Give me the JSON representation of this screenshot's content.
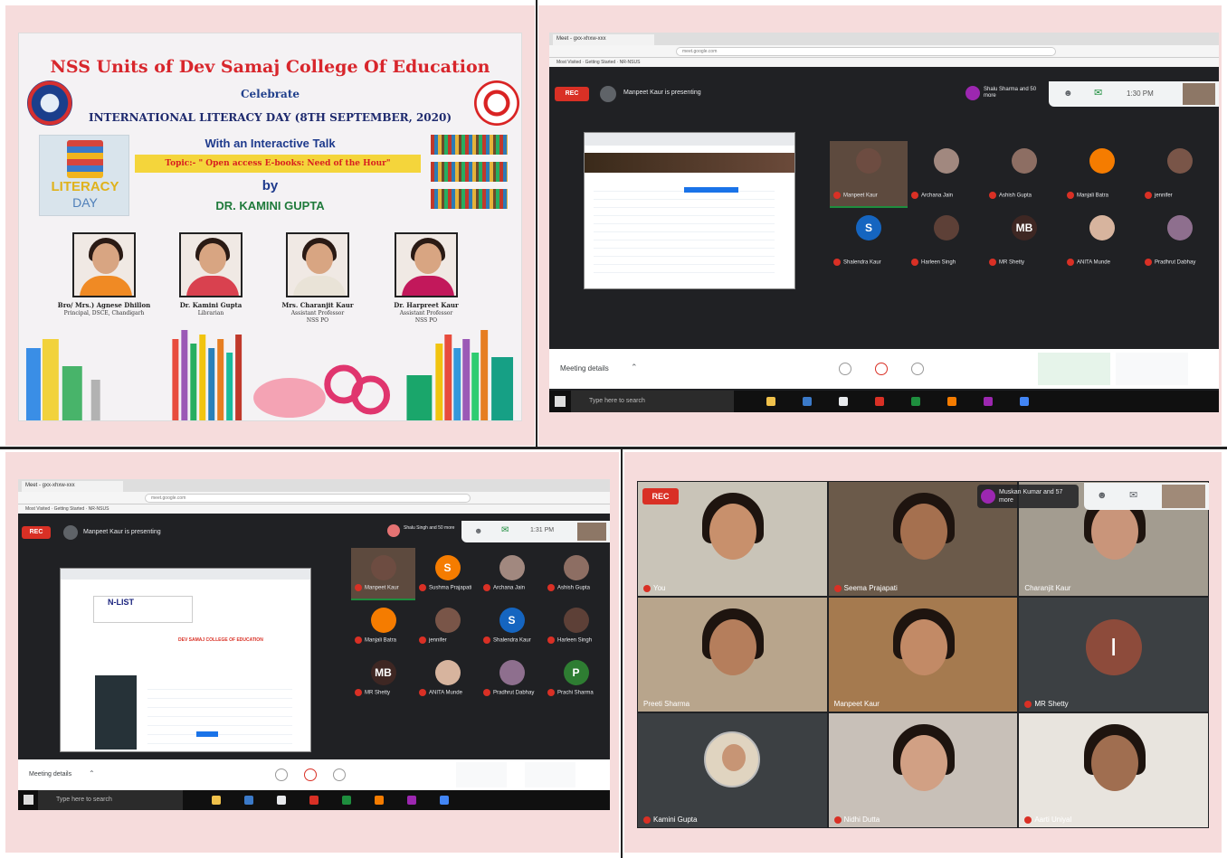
{
  "poster": {
    "title": "NSS Units of Dev Samaj College Of Education",
    "celebrate": "Celebrate",
    "day": "INTERNATIONAL LITERACY DAY (8TH SEPTEMBER, 2020)",
    "talk": "With an Interactive Talk",
    "topic": "Topic:- \" Open access E-books: Need of the Hour\"",
    "by": "by",
    "speaker": "DR. KAMINI GUPTA",
    "logo_text": "LITERACY",
    "logo_day": "DAY",
    "people": [
      {
        "name": "Bro/ Mrs.) Agnese Dhillon",
        "role": "Principal, DSCE, Chandigarh",
        "color": "#f08a24"
      },
      {
        "name": "Dr. Kamini Gupta",
        "role": "Librarian",
        "color": "#d9414f"
      },
      {
        "name": "Mrs. Charanjit Kaur",
        "role": "Assistant Professor\nNSS PO",
        "color": "#e9e3d7"
      },
      {
        "name": "Dr. Harpreet Kaur",
        "role": "Assistant Professor\nNSS PO",
        "color": "#c2185b"
      }
    ]
  },
  "meet1": {
    "tab_label": "Meet - gxx-xhxw-xxx",
    "rec": "REC",
    "presenting": "Manpeet Kaur is presenting",
    "presenter_chip": "Shalu Sharma and 50 more",
    "time": "1:30 PM",
    "meeting_details": "Meeting details",
    "search_placeholder": "Type here to search",
    "tiles": [
      {
        "name": "Manpeet Kaur",
        "initial": "",
        "color": "#6d4c41"
      },
      {
        "name": "Archana Jain",
        "initial": "",
        "color": "#a1887f"
      },
      {
        "name": "Ashish Gupta",
        "initial": "",
        "color": "#8d6e63"
      },
      {
        "name": "Manjali Batra",
        "initial": "",
        "color": "#f57c00"
      },
      {
        "name": "jennifer",
        "initial": "",
        "color": "#795548"
      },
      {
        "name": "Shalendra Kaur",
        "initial": "S",
        "color": "#1565c0"
      },
      {
        "name": "Harleen Singh",
        "initial": "",
        "color": "#5d4037"
      },
      {
        "name": "MR Shetty",
        "initial": "MB",
        "color": "#3e2723"
      },
      {
        "name": "ANITA Munde",
        "initial": "",
        "color": "#d7b49e"
      },
      {
        "name": "Pradhrut Dabhay",
        "initial": "",
        "color": "#8e6f8e"
      }
    ]
  },
  "meet2": {
    "tab_label": "Meet - gxx-xhxw-xxx",
    "rec": "REC",
    "presenting": "Manpeet Kaur is presenting",
    "presenter_chip": "Shalu Singh and 50 more",
    "time": "1:31 PM",
    "meeting_details": "Meeting details",
    "search_placeholder": "Type here to search",
    "shared_title": "N-LIST",
    "shared_subtitle": "DEV SAMAJ COLLEGE OF EDUCATION",
    "tiles": [
      {
        "name": "Manpeet Kaur",
        "initial": "",
        "color": "#6d4c41"
      },
      {
        "name": "Sushma Prajapati",
        "initial": "S",
        "color": "#f57c00"
      },
      {
        "name": "Archana Jain",
        "initial": "",
        "color": "#a1887f"
      },
      {
        "name": "Ashish Gupta",
        "initial": "",
        "color": "#8d6e63"
      },
      {
        "name": "Manjali Batra",
        "initial": "",
        "color": "#f57c00"
      },
      {
        "name": "jennifer",
        "initial": "",
        "color": "#795548"
      },
      {
        "name": "Shalendra Kaur",
        "initial": "S",
        "color": "#1565c0"
      },
      {
        "name": "Harleen Singh",
        "initial": "",
        "color": "#5d4037"
      },
      {
        "name": "MR Shetty",
        "initial": "MB",
        "color": "#3e2723"
      },
      {
        "name": "ANITA Munde",
        "initial": "",
        "color": "#d7b49e"
      },
      {
        "name": "Pradhrut Dabhay",
        "initial": "",
        "color": "#8e6f8e"
      },
      {
        "name": "Prachi Sharma",
        "initial": "P",
        "color": "#2e7d32"
      }
    ]
  },
  "grid": {
    "rec": "REC",
    "chip": "Muskan Kumar and 57 more",
    "tiles": [
      {
        "name": "You",
        "bg": "#c9c4b8",
        "skin": "#c8906c",
        "mic": true
      },
      {
        "name": "Seema Prajapati",
        "bg": "#6b5a4a",
        "skin": "#a5704f",
        "mic": true
      },
      {
        "name": "Charanjit Kaur",
        "bg": "#a39c90",
        "skin": "#c9957a",
        "mic": false
      },
      {
        "name": "Preeti Sharma",
        "bg": "#b8a58c",
        "skin": "#b57e5c",
        "mic": false
      },
      {
        "name": "Manpeet Kaur",
        "bg": "#a57a4f",
        "skin": "#c28a66",
        "mic": false
      },
      {
        "name": "MR Shetty",
        "bg": "#3c4043",
        "skin": "",
        "initial": "I",
        "mic": true
      },
      {
        "name": "Kamini Gupta",
        "bg": "#3c4043",
        "skin": "#c79575",
        "mic": true
      },
      {
        "name": "Nidhi Dutta",
        "bg": "#c8c0b8",
        "skin": "#d1a084",
        "mic": true
      },
      {
        "name": "Aarti Uniyal",
        "bg": "#e8e4de",
        "skin": "#a06e50",
        "mic": true
      }
    ]
  },
  "colors": {
    "meet_dark": "#202124",
    "rec_red": "#d93025",
    "frame_pink": "#f6dcdc"
  }
}
